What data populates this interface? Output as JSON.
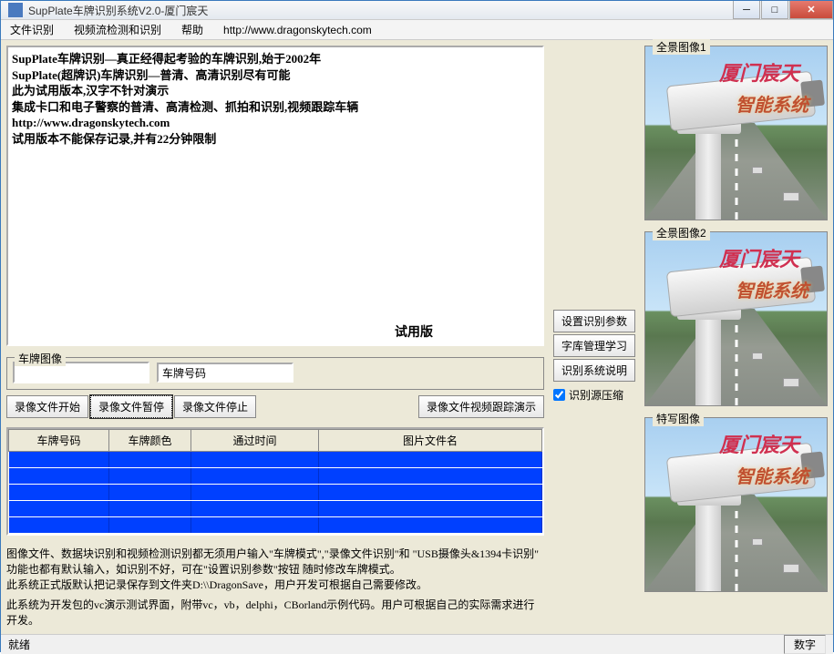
{
  "window": {
    "title": "SupPlate车牌识别系统V2.0-厦门宸天"
  },
  "menu": {
    "file_rec": "文件识别",
    "video_rec": "视频流检测和识别",
    "help": "帮助",
    "url": "http://www.dragonskytech.com"
  },
  "intro_text": "SupPlate车牌识别—真正经得起考验的车牌识别,始于2002年\nSupPlate(超牌识)车牌识别—普清、高清识别尽有可能\n此为试用版本,汉字不针对演示\n集成卡口和电子警察的普清、高清检测、抓拍和识别,视频跟踪车辆\nhttp://www.dragonskytech.com\n试用版本不能保存记录,并有22分钟限制",
  "trial_label": "试用版",
  "plate": {
    "group_label": "车牌图像",
    "num_label": "车牌号码"
  },
  "buttons": {
    "rec_start": "录像文件开始",
    "rec_pause": "录像文件暂停",
    "rec_stop": "录像文件停止",
    "rec_demo": "录像文件视频跟踪演示",
    "set_params": "设置识别参数",
    "font_learn": "字库管理学习",
    "sys_desc": "识别系统说明"
  },
  "checkbox": {
    "compress": "识别源压缩"
  },
  "table": {
    "col_plate": "车牌号码",
    "col_color": "车牌颜色",
    "col_time": "通过时间",
    "col_file": "图片文件名"
  },
  "footer": {
    "line1": "图像文件、数据块识别和视频检测识别都无须用户输入\"车牌模式\",\"录像文件识别\"和 \"USB摄像头&1394卡识别\" 功能也都有默认输入，如识别不好，可在\"设置识别参数\"按钮 随时修改车牌模式。",
    "line2": "此系统正式版默认把记录保存到文件夹D:\\\\DragonSave，用户开发可根据自己需要修改。",
    "line3": "此系统为开发包的vc演示测试界面，附带vc，vb，delphi，CBorland示例代码。用户可根据自己的实际需求进行开发。"
  },
  "panels": {
    "pano1": "全景图像1",
    "pano2": "全景图像2",
    "closeup": "特写图像",
    "overlay1": "厦门宸天",
    "overlay2": "智能系统"
  },
  "status": {
    "left": "就绪",
    "right": "数字"
  }
}
